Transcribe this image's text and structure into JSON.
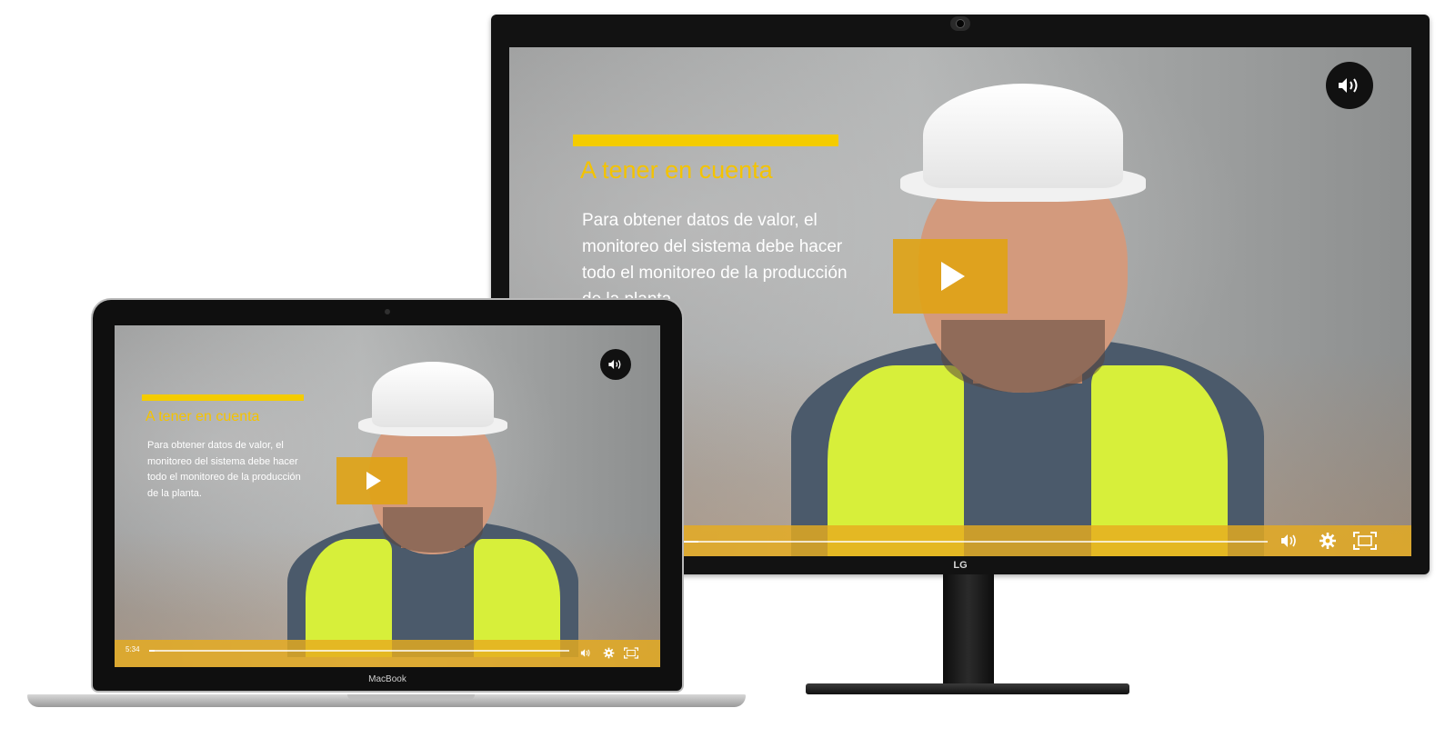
{
  "monitor": {
    "brand": "LG",
    "video": {
      "title": "A tener en cuenta",
      "body": "Para obtener datos de valor, el monitoreo del sistema debe hacer todo el monitoreo de la producción de la planta.",
      "icons": {
        "play": "play-icon",
        "sound": "volume-icon",
        "settings": "gear-icon",
        "fullscreen": "fullscreen-icon"
      }
    }
  },
  "laptop": {
    "brand": "MacBook",
    "video": {
      "title": "A tener en cuenta",
      "body": "Para obtener datos de valor, el monitoreo del sistema debe hacer todo el monitoreo de la producción de la planta.",
      "time": "5:34"
    }
  },
  "colors": {
    "accent_yellow": "#f4cc00",
    "player_bar": "#e6ac1e",
    "play_button": "#e0a314"
  }
}
